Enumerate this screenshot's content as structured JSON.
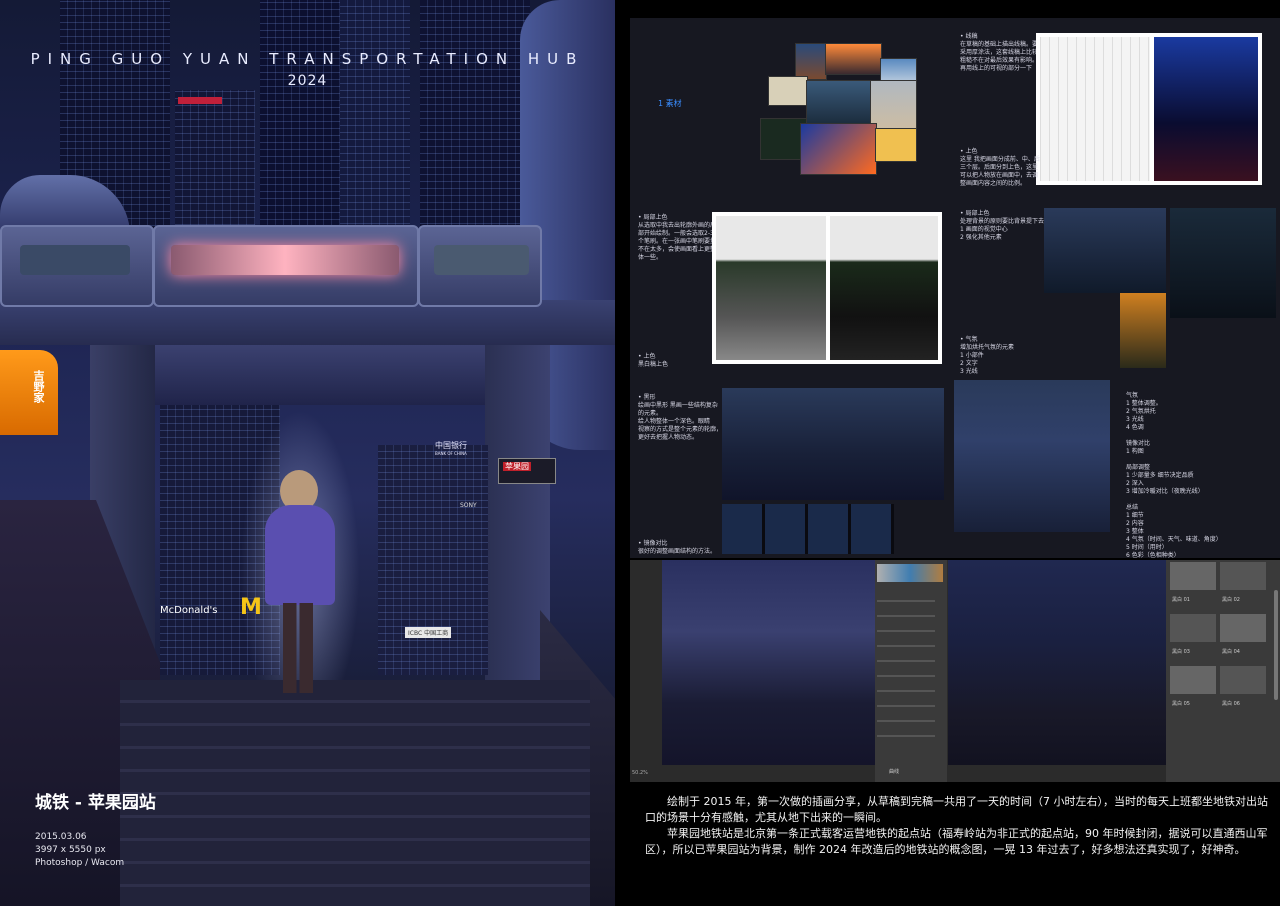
{
  "poster": {
    "title": "PING GUO YUAN TRANSPORTATION HUB",
    "year": "2024",
    "caption": "城铁 - 苹果园站",
    "date": "2015.03.06",
    "size": "3997 x 5550 px",
    "tools": "Photoshop / Wacom",
    "sign_station": "苹果园",
    "sign_bank": "中国银行",
    "sign_bank_en": "BANK OF CHINA",
    "sign_sony": "SONY",
    "sign_mcd": "McDonald's",
    "sign_store": "吉野家",
    "sign_icbc": "ICBC 中国工商"
  },
  "process": {
    "step1": "1 素材",
    "lineart": "• 线稿\n在草稿的基础上描出线稿。要\n采用厚涂法，这套线稿上比较\n粗糙不在对最后效果有影响。\n再用线上的可视的部分一下",
    "color1": "• 上色\n这里 我把画面分成前、中、后\n三个层。后面分到上色，这里\n可以把人物放在画面中，去调\n整画面内容之间的比例。",
    "local_color": "• 局部上色\n从选取中我去出轮廓外画的局\n部开始绘制。一般会选取2-3\n个笔刷。在一张画中笔刷要量\n不在太多，会使画面看上更整\n体一些。",
    "local_color2": "• 局部上色\n处理背景的原则要比背景提下去。\n1 画面的视觉中心\n2 强化其他元素",
    "base_color": "• 上色\n黑白稿上色",
    "atmosphere": "• 气氛\n增加烘托气氛的元素\n1 小部件\n2 文字\n3 光线",
    "shadow": "• 黑形\n绘画中黑形 黑画一些结构复杂\n的元素。\n给人物整体一个深色。眼睛\n视察的方式是整个元素的轮廓，\n更好去把握人物动态。",
    "adjust_list": "气氛\n1 整体调整。\n2 气氛烘托\n3 光线\n4 色调\n\n镜像对比\n1 构图\n\n局部调整\n1 少部量多 细节决定品质\n2 深入\n3 增加冷暖对比（夜晚光线）\n\n总结\n1 细节\n2 内容\n3 整体\n4 气氛（时间、天气、味道、角度）\n5 时间（用时）\n6 色彩（色相种类）",
    "mirror": "• 镜像对比\n很好的调整画面结构的方法。"
  },
  "photoshop": {
    "panel_title": "曲线",
    "zoom": "50.2%",
    "layers": [
      "黑白 01",
      "黑白 02",
      "黑白 03",
      "黑白 04",
      "黑白 05",
      "黑白 06"
    ]
  },
  "description": {
    "p1": "绘制于 2015 年，第一次做的插画分享，从草稿到完稿一共用了一天的时间（7 小时左右），当时的每天上班都坐地铁对出站口的场景十分有感触，尤其从地下出来的一瞬间。",
    "p2": "苹果园地铁站是北京第一条正式载客运营地铁的起点站（福寿岭站为非正式的起点站，90 年时候封闭，据说可以直通西山军区），所以已苹果园站为背景，制作 2024 年改造后的地铁站的概念图，一晃 13 年过去了，好多想法还真实现了，好神奇。"
  }
}
